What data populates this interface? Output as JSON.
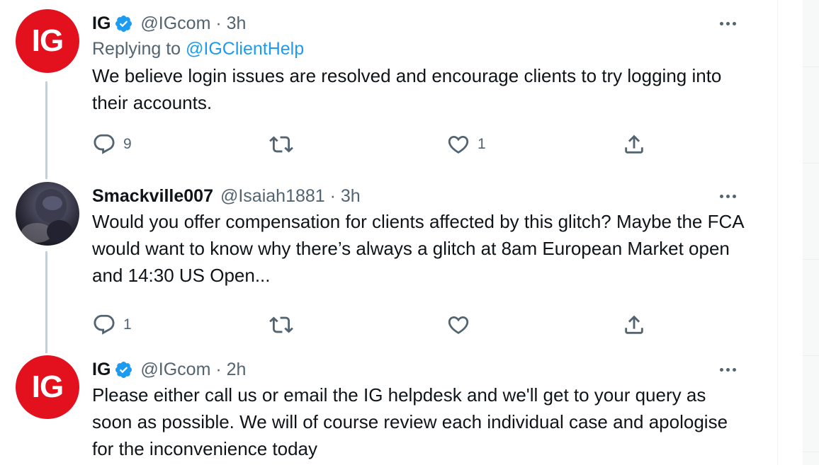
{
  "tweets": [
    {
      "name": "IG",
      "handle": "@IGcom",
      "time": "3h",
      "meta": "@IGcom · 3h",
      "avatar_text": "IG",
      "replying_prefix": "Replying to",
      "replying_to": "@IGClientHelp",
      "text": "We believe login issues are resolved and encourage clients to try logging into their accounts.",
      "reply_count": "9",
      "retweet_count": "",
      "like_count": "1"
    },
    {
      "name": "Smackville007",
      "handle": "@Isaiah1881",
      "time": "3h",
      "meta": "@Isaiah1881 · 3h",
      "text": "Would you offer compensation for clients affected by this glitch? Maybe the FCA would want to know why there’s always a glitch at 8am European Market open and 14:30 US Open...",
      "reply_count": "1",
      "retweet_count": "",
      "like_count": ""
    },
    {
      "name": "IG",
      "handle": "@IGcom",
      "time": "2h",
      "meta": "@IGcom · 2h",
      "avatar_text": "IG",
      "text": "Please either call us or email the IG helpdesk and we'll get to your query as soon as possible. We will of course review each individual case and apologise for the inconvenience today"
    }
  ],
  "colors": {
    "brand_red": "#e3101e",
    "verified_blue": "#1d9bf0",
    "secondary_text": "#536471",
    "thread_line": "#c4cfd6"
  },
  "icons": {
    "verified": "verified-badge-icon",
    "reply": "reply-icon",
    "retweet": "retweet-icon",
    "like": "heart-icon",
    "share": "share-icon",
    "more": "more-options-icon"
  }
}
